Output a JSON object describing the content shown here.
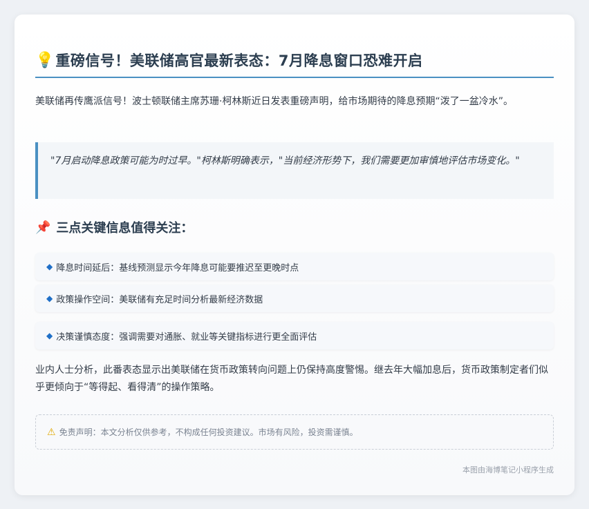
{
  "article": {
    "title_icon": "lightbulb-icon",
    "title_emoji": "💡",
    "title": "重磅信号！美联储高官最新表态：7月降息窗口恐难开启",
    "intro": "美联储再传鹰派信号！波士顿联储主席苏珊·柯林斯近日发表重磅声明，给市场期待的降息预期“泼了一盆冷水”。",
    "quote": "\"7月启动降息政策可能为时过早。\"柯林斯明确表示，\"当前经济形势下，我们需要更加审慎地评估市场变化。\"",
    "section_icon": "pushpin-icon",
    "section_emoji": "📌",
    "section_title": "三点关键信息值得关注：",
    "bullet_icon": "diamond-icon",
    "bullet_glyph": "◆",
    "points": [
      "降息时间延后：基线预测显示今年降息可能要推迟至更晚时点",
      "政策操作空间：美联储有充足时间分析最新经济数据",
      "决策谨慎态度：强调需要对通胀、就业等关键指标进行更全面评估"
    ],
    "analysis": "业内人士分析，此番表态显示出美联储在货币政策转向问题上仍保持高度警惕。继去年大幅加息后，货币政策制定者们似乎更倾向于“等得起、看得清”的操作策略。",
    "disclaimer_icon": "warning-icon",
    "disclaimer_glyph": "⚠",
    "disclaimer": "免责声明：本文分析仅供参考，不构成任何投资建议。市场有风险，投资需谨慎。",
    "footer": "本图由海博笔记小程序生成"
  },
  "colors": {
    "accent": "#4a90c2",
    "heading": "#2c3e50",
    "bullet": "#1f6fc7"
  }
}
